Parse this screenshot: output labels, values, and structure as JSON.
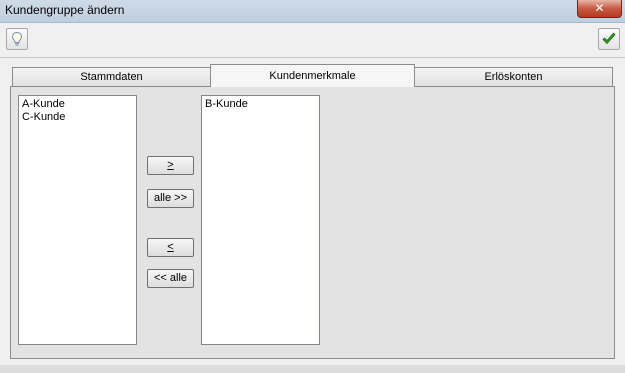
{
  "window": {
    "title": "Kundengruppe ändern",
    "close_label": "✕"
  },
  "toolbar": {
    "hint_icon": "lightbulb-icon",
    "confirm_icon": "checkmark-icon",
    "confirm_color": "#3a9a2a"
  },
  "tabs": [
    {
      "label": "Stammdaten",
      "active": false
    },
    {
      "label": "Kundenmerkmale",
      "active": true
    },
    {
      "label": "Erlöskonten",
      "active": false
    }
  ],
  "available_list": {
    "items": [
      "A-Kunde",
      "C-Kunde"
    ]
  },
  "selected_list": {
    "items": [
      "B-Kunde"
    ]
  },
  "transfer_buttons": {
    "add_one": ">",
    "add_all": "alle >>",
    "remove_one": "<",
    "remove_all": "<< alle"
  }
}
